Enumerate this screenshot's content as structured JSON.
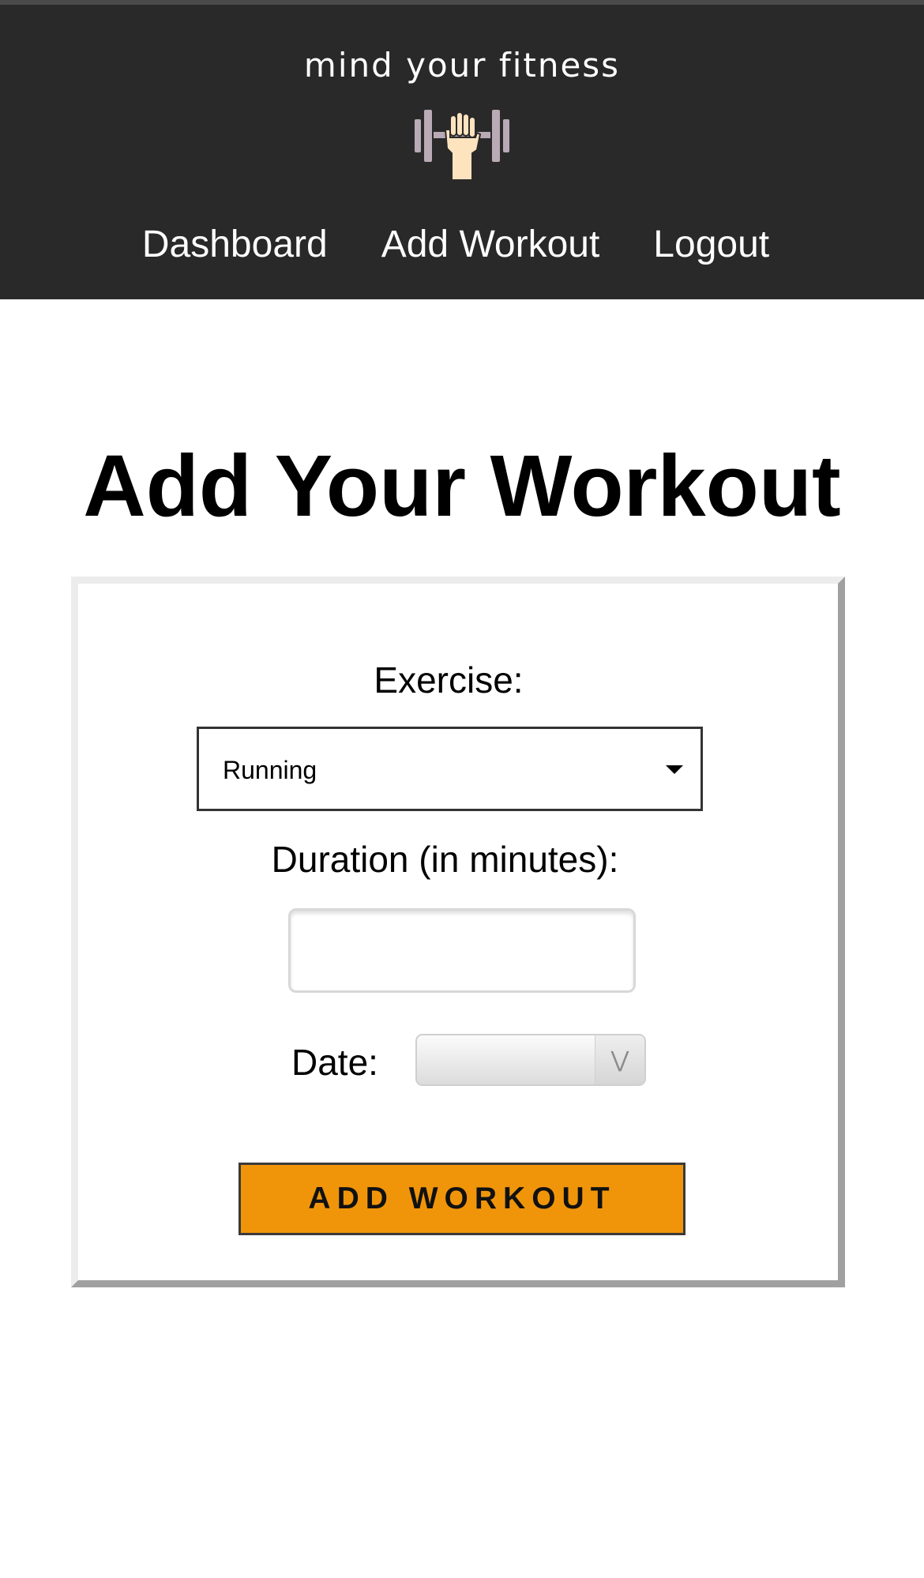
{
  "header": {
    "brand": "mind your fitness",
    "logo_icon": "dumbbell-fist-icon",
    "colors": {
      "background": "#292929",
      "text": "#ffffff"
    }
  },
  "nav": {
    "items": [
      {
        "label": "Dashboard"
      },
      {
        "label": "Add Workout"
      },
      {
        "label": "Logout"
      }
    ]
  },
  "main": {
    "title": "Add Your Workout"
  },
  "form": {
    "exercise_label": "Exercise:",
    "exercise_value": "Running",
    "duration_label": "Duration (in minutes):",
    "duration_value": "",
    "date_label": "Date:",
    "date_value": "",
    "date_arrow_icon": "chevron-down-icon",
    "submit_label": "ADD WORKOUT",
    "colors": {
      "submit_background": "#f0950a"
    }
  }
}
